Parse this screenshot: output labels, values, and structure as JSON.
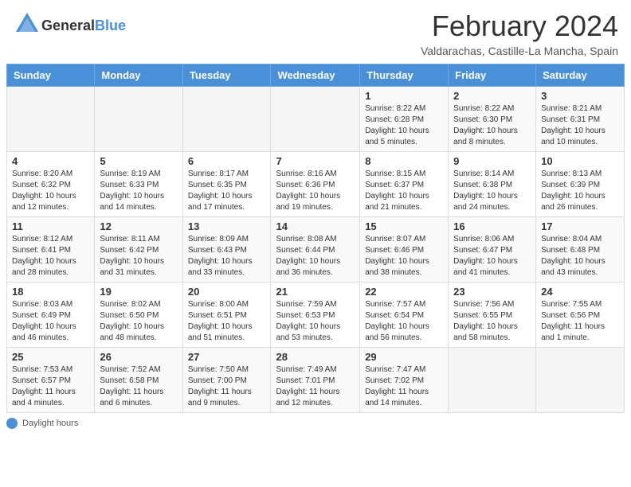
{
  "header": {
    "logo_general": "General",
    "logo_blue": "Blue",
    "title": "February 2024",
    "location": "Valdarachas, Castille-La Mancha, Spain"
  },
  "days_of_week": [
    "Sunday",
    "Monday",
    "Tuesday",
    "Wednesday",
    "Thursday",
    "Friday",
    "Saturday"
  ],
  "weeks": [
    [
      {
        "day": "",
        "info": ""
      },
      {
        "day": "",
        "info": ""
      },
      {
        "day": "",
        "info": ""
      },
      {
        "day": "",
        "info": ""
      },
      {
        "day": "1",
        "info": "Sunrise: 8:22 AM\nSunset: 6:28 PM\nDaylight: 10 hours\nand 5 minutes."
      },
      {
        "day": "2",
        "info": "Sunrise: 8:22 AM\nSunset: 6:30 PM\nDaylight: 10 hours\nand 8 minutes."
      },
      {
        "day": "3",
        "info": "Sunrise: 8:21 AM\nSunset: 6:31 PM\nDaylight: 10 hours\nand 10 minutes."
      }
    ],
    [
      {
        "day": "4",
        "info": "Sunrise: 8:20 AM\nSunset: 6:32 PM\nDaylight: 10 hours\nand 12 minutes."
      },
      {
        "day": "5",
        "info": "Sunrise: 8:19 AM\nSunset: 6:33 PM\nDaylight: 10 hours\nand 14 minutes."
      },
      {
        "day": "6",
        "info": "Sunrise: 8:17 AM\nSunset: 6:35 PM\nDaylight: 10 hours\nand 17 minutes."
      },
      {
        "day": "7",
        "info": "Sunrise: 8:16 AM\nSunset: 6:36 PM\nDaylight: 10 hours\nand 19 minutes."
      },
      {
        "day": "8",
        "info": "Sunrise: 8:15 AM\nSunset: 6:37 PM\nDaylight: 10 hours\nand 21 minutes."
      },
      {
        "day": "9",
        "info": "Sunrise: 8:14 AM\nSunset: 6:38 PM\nDaylight: 10 hours\nand 24 minutes."
      },
      {
        "day": "10",
        "info": "Sunrise: 8:13 AM\nSunset: 6:39 PM\nDaylight: 10 hours\nand 26 minutes."
      }
    ],
    [
      {
        "day": "11",
        "info": "Sunrise: 8:12 AM\nSunset: 6:41 PM\nDaylight: 10 hours\nand 28 minutes."
      },
      {
        "day": "12",
        "info": "Sunrise: 8:11 AM\nSunset: 6:42 PM\nDaylight: 10 hours\nand 31 minutes."
      },
      {
        "day": "13",
        "info": "Sunrise: 8:09 AM\nSunset: 6:43 PM\nDaylight: 10 hours\nand 33 minutes."
      },
      {
        "day": "14",
        "info": "Sunrise: 8:08 AM\nSunset: 6:44 PM\nDaylight: 10 hours\nand 36 minutes."
      },
      {
        "day": "15",
        "info": "Sunrise: 8:07 AM\nSunset: 6:46 PM\nDaylight: 10 hours\nand 38 minutes."
      },
      {
        "day": "16",
        "info": "Sunrise: 8:06 AM\nSunset: 6:47 PM\nDaylight: 10 hours\nand 41 minutes."
      },
      {
        "day": "17",
        "info": "Sunrise: 8:04 AM\nSunset: 6:48 PM\nDaylight: 10 hours\nand 43 minutes."
      }
    ],
    [
      {
        "day": "18",
        "info": "Sunrise: 8:03 AM\nSunset: 6:49 PM\nDaylight: 10 hours\nand 46 minutes."
      },
      {
        "day": "19",
        "info": "Sunrise: 8:02 AM\nSunset: 6:50 PM\nDaylight: 10 hours\nand 48 minutes."
      },
      {
        "day": "20",
        "info": "Sunrise: 8:00 AM\nSunset: 6:51 PM\nDaylight: 10 hours\nand 51 minutes."
      },
      {
        "day": "21",
        "info": "Sunrise: 7:59 AM\nSunset: 6:53 PM\nDaylight: 10 hours\nand 53 minutes."
      },
      {
        "day": "22",
        "info": "Sunrise: 7:57 AM\nSunset: 6:54 PM\nDaylight: 10 hours\nand 56 minutes."
      },
      {
        "day": "23",
        "info": "Sunrise: 7:56 AM\nSunset: 6:55 PM\nDaylight: 10 hours\nand 58 minutes."
      },
      {
        "day": "24",
        "info": "Sunrise: 7:55 AM\nSunset: 6:56 PM\nDaylight: 11 hours\nand 1 minute."
      }
    ],
    [
      {
        "day": "25",
        "info": "Sunrise: 7:53 AM\nSunset: 6:57 PM\nDaylight: 11 hours\nand 4 minutes."
      },
      {
        "day": "26",
        "info": "Sunrise: 7:52 AM\nSunset: 6:58 PM\nDaylight: 11 hours\nand 6 minutes."
      },
      {
        "day": "27",
        "info": "Sunrise: 7:50 AM\nSunset: 7:00 PM\nDaylight: 11 hours\nand 9 minutes."
      },
      {
        "day": "28",
        "info": "Sunrise: 7:49 AM\nSunset: 7:01 PM\nDaylight: 11 hours\nand 12 minutes."
      },
      {
        "day": "29",
        "info": "Sunrise: 7:47 AM\nSunset: 7:02 PM\nDaylight: 11 hours\nand 14 minutes."
      },
      {
        "day": "",
        "info": ""
      },
      {
        "day": "",
        "info": ""
      }
    ]
  ],
  "footer": {
    "daylight_hours_label": "Daylight hours"
  }
}
